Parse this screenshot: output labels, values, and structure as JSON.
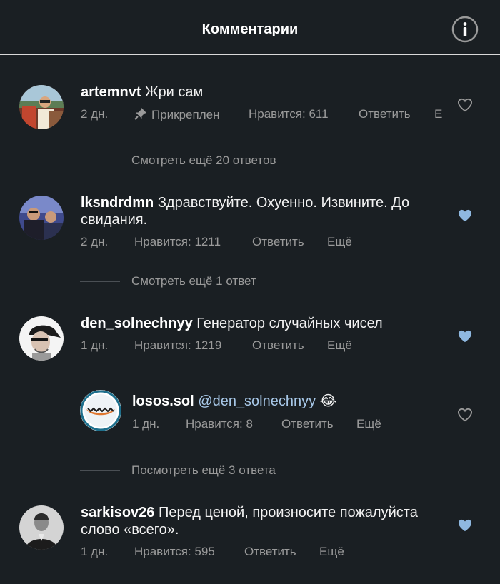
{
  "header": {
    "title": "Комментарии",
    "info_icon": "info-icon"
  },
  "comments": [
    {
      "username": "artemnvt",
      "text": "Жри сам",
      "time": "2 дн.",
      "pinned": "Прикреплен",
      "likes": "Нравится: 611",
      "reply": "Ответить",
      "more": "Е",
      "liked": false,
      "view_replies": "Смотреть ещё 20 ответов"
    },
    {
      "username": "lksndrdmn",
      "text": "Здравствуйте. Охуенно. Извините. До свидания.",
      "time": "2 дн.",
      "likes": "Нравится: 1211",
      "reply": "Ответить",
      "more": "Ещё",
      "liked": true,
      "view_replies": "Смотреть ещё 1 ответ"
    },
    {
      "username": "den_solnechnyy",
      "text": "Генератор случайных чисел",
      "time": "1 дн.",
      "likes": "Нравится: 1219",
      "reply": "Ответить",
      "more": "Ещё",
      "liked": true
    },
    {
      "username": "losos.sol",
      "mention": "@den_solnechnyy",
      "emoji": "😂",
      "time": "1 дн.",
      "likes": "Нравится: 8",
      "reply": "Ответить",
      "more": "Ещё",
      "liked": false,
      "is_reply": true,
      "view_replies": "Посмотреть ещё 3 ответа"
    },
    {
      "username": "sarkisov26",
      "text": "Перед ценой, произносите пожалуйста слово «всего».",
      "time": "1 дн.",
      "likes": "Нравится: 595",
      "reply": "Ответить",
      "more": "Ещё",
      "liked": true
    }
  ],
  "colors": {
    "background": "#1a1f23",
    "text_primary": "#ffffff",
    "text_secondary": "#9a9a9a",
    "heart_liked": "#8fb8e0",
    "mention": "#a7c7e7"
  }
}
